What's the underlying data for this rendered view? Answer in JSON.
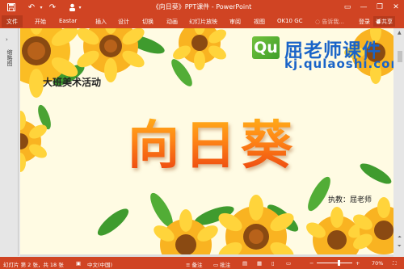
{
  "window": {
    "title": "《向日葵》PPT课件 - PowerPoint",
    "save_icon": "save-icon",
    "undo_glyph": "↶",
    "redo_glyph": "↷",
    "minimize_glyph": "—",
    "restore_glyph": "❐",
    "close_glyph": "✕",
    "ribbon_options_glyph": "▭"
  },
  "ribbon": {
    "file": "文件",
    "tabs": [
      "开始",
      "Eastar",
      "插入",
      "设计",
      "切换",
      "动画",
      "幻灯片放映",
      "审阅",
      "视图",
      "OK10 GC"
    ],
    "tell_me": "告诉我...",
    "login": "登录",
    "share": "共享"
  },
  "sidebar": {
    "collapse_glyph": "›",
    "label": "缩略图"
  },
  "slide": {
    "logo_mark": "Qu",
    "logo_name": "屈老师课件",
    "logo_url": "kj.qulaoshi.com",
    "subtitle": "大班美术活动",
    "title": "向日葵",
    "teacher": "执教：屈老师"
  },
  "statusbar": {
    "slide_info": "幻灯片 第 2 张，共 18 张",
    "language": "中文(中国)",
    "notes": "备注",
    "comments": "批注",
    "zoom_minus": "−",
    "zoom_plus": "+",
    "zoom": "70%"
  },
  "colors": {
    "accent": "#d04423",
    "slide_bg": "#fffbe3",
    "title_orange": "#f25a12",
    "logo_blue": "#1a64c8",
    "logo_green": "#5ab535"
  }
}
